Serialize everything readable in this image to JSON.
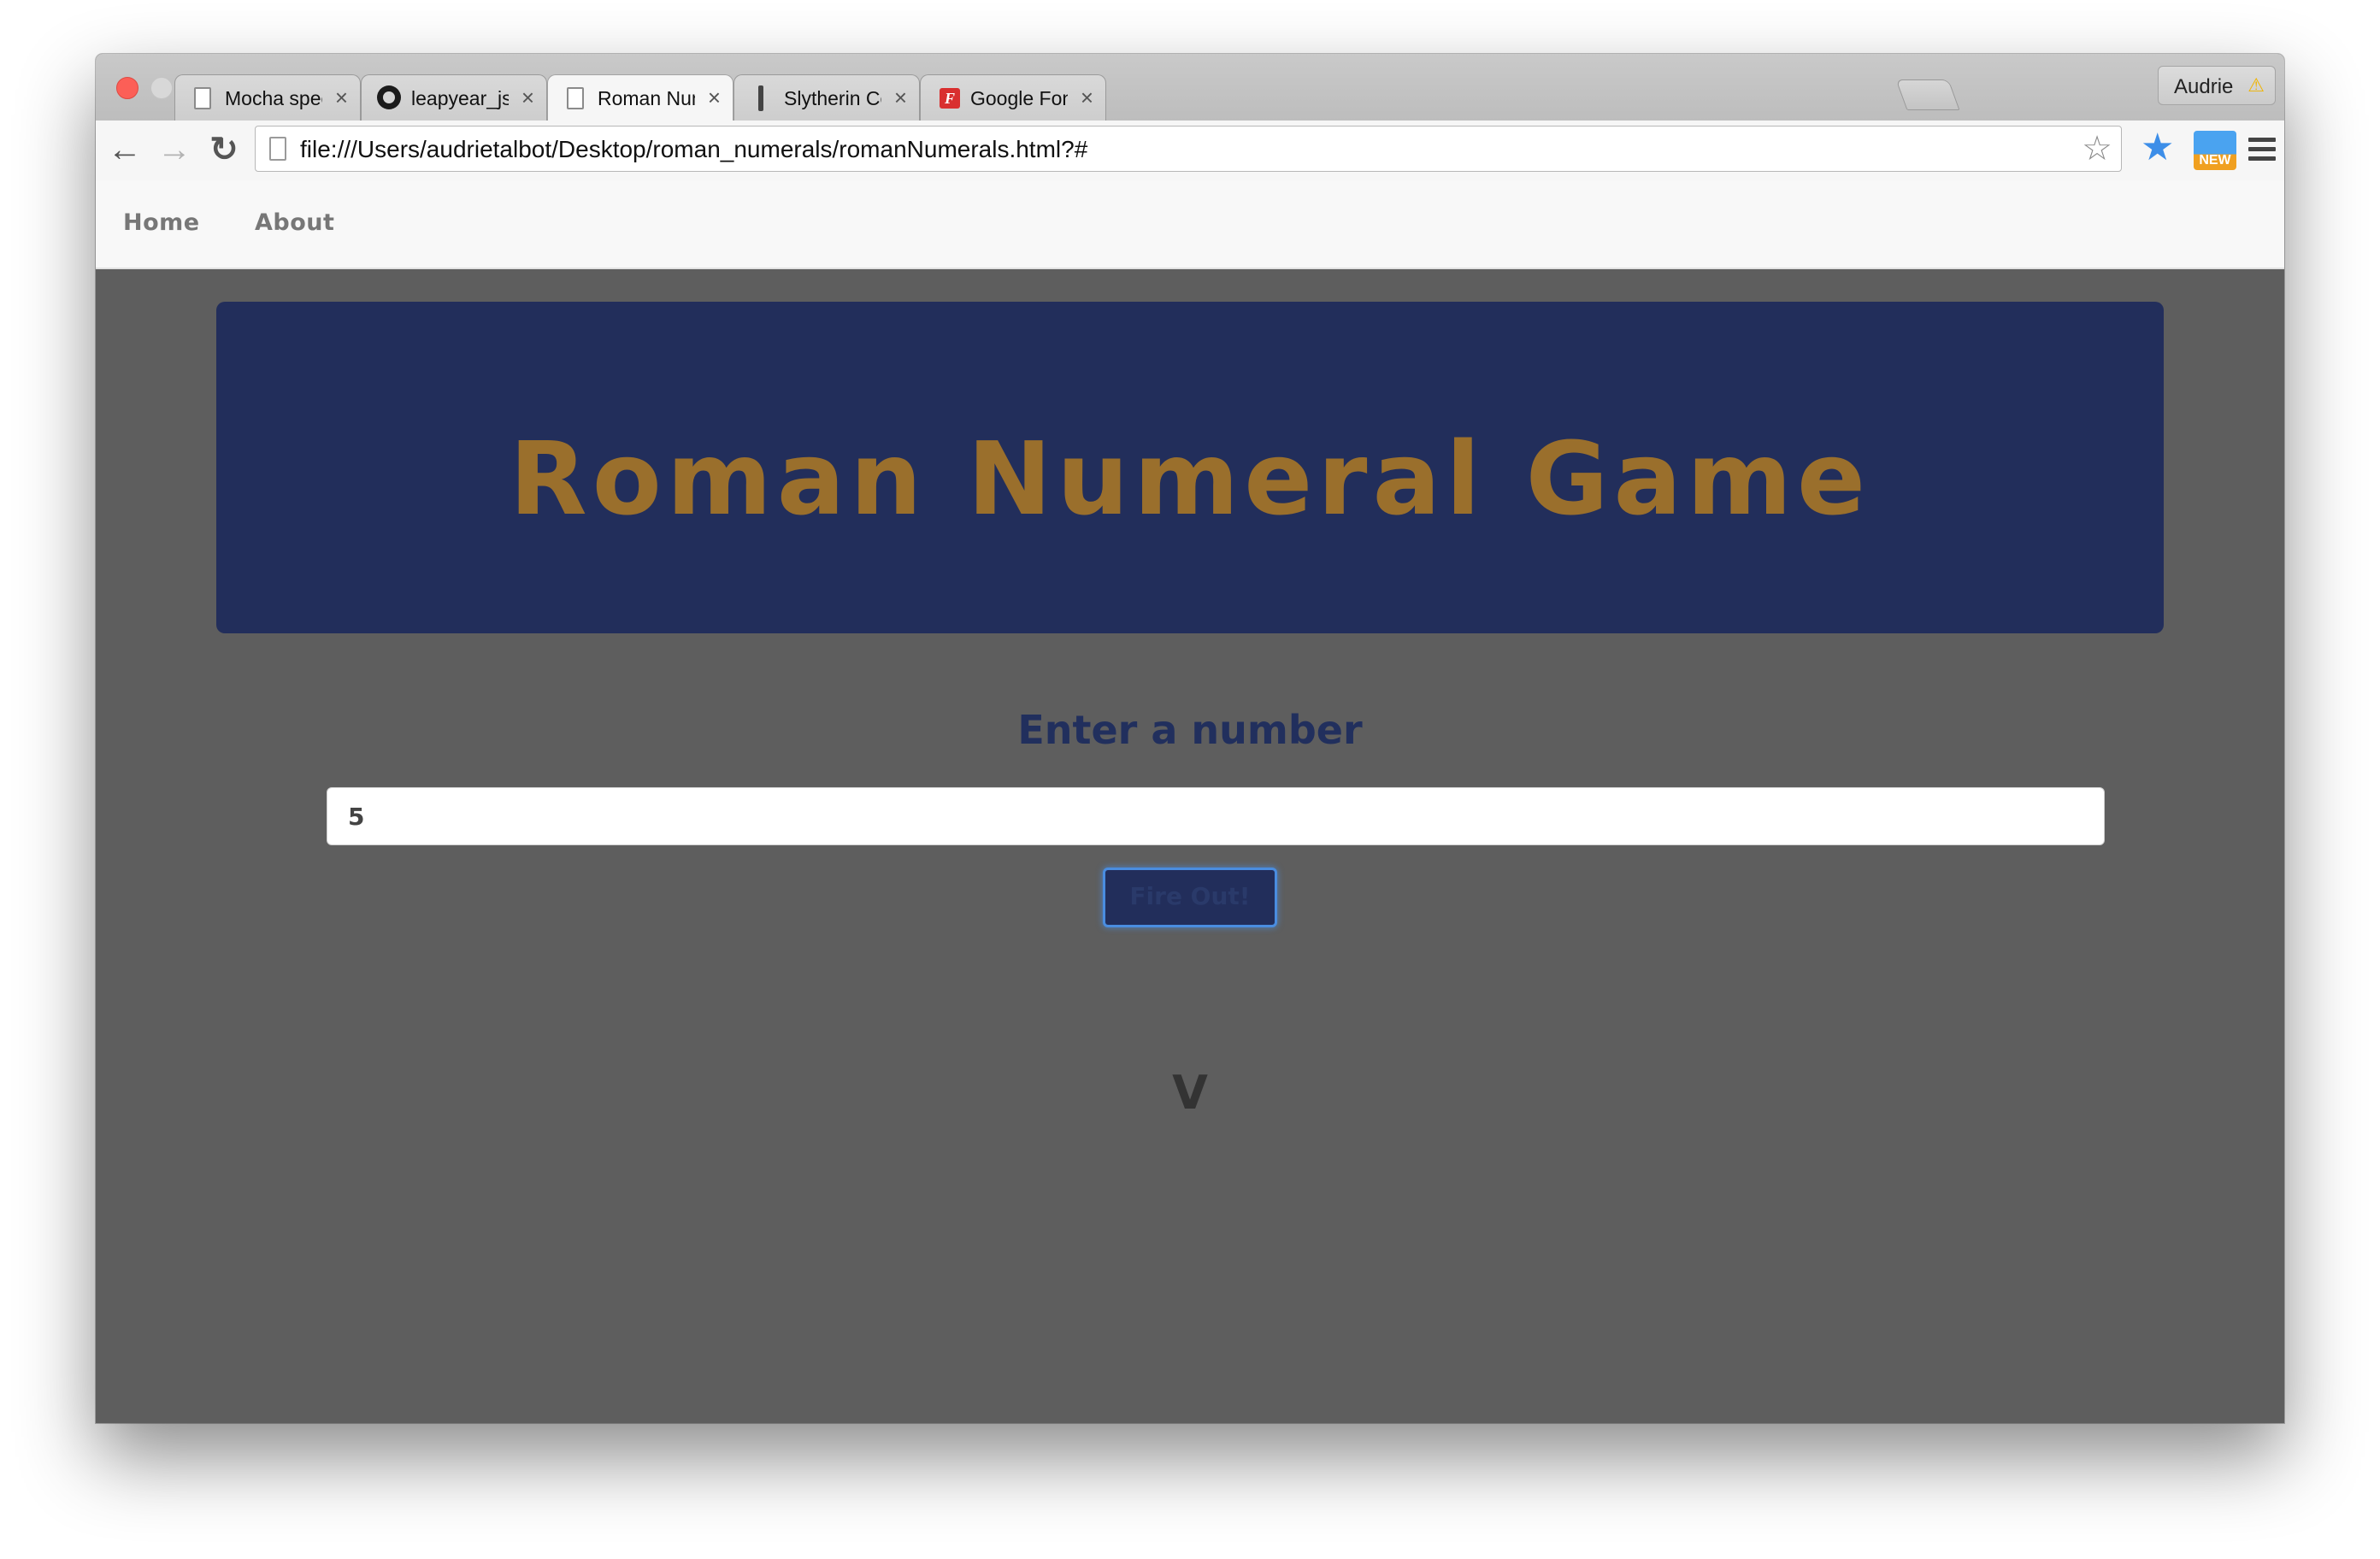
{
  "browser": {
    "tabs": [
      {
        "title": "Mocha spec runner",
        "icon": "page-icon",
        "active": false
      },
      {
        "title": "leapyear_js/styles.css at m",
        "icon": "github-icon",
        "active": false
      },
      {
        "title": "Roman Numeral Game",
        "icon": "page-icon",
        "active": true
      },
      {
        "title": "Slytherin Color Palette",
        "icon": "palette-icon",
        "active": false
      },
      {
        "title": "Google Fonts",
        "icon": "google-fonts-icon",
        "active": false
      }
    ],
    "tab_close_glyph": "×",
    "profile_name": "Audrie",
    "profile_warning": "⚠",
    "url": "file:///Users/audrietalbot/Desktop/roman_numerals/romanNumerals.html?#",
    "back_glyph": "←",
    "forward_glyph": "→",
    "reload_glyph": "↻",
    "bookmark_glyph": "☆",
    "extension_star_glyph": "★",
    "extension_new_label": "NEW"
  },
  "page": {
    "nav": {
      "home": "Home",
      "about": "About"
    },
    "title": "Roman Numeral Game",
    "prompt": "Enter a number",
    "input_value": "5",
    "button_label": "Fire Out!",
    "result": "V",
    "colors": {
      "jumbotron": "#222e5b",
      "title": "#9a6f2c",
      "background": "#5e5e5e"
    }
  }
}
